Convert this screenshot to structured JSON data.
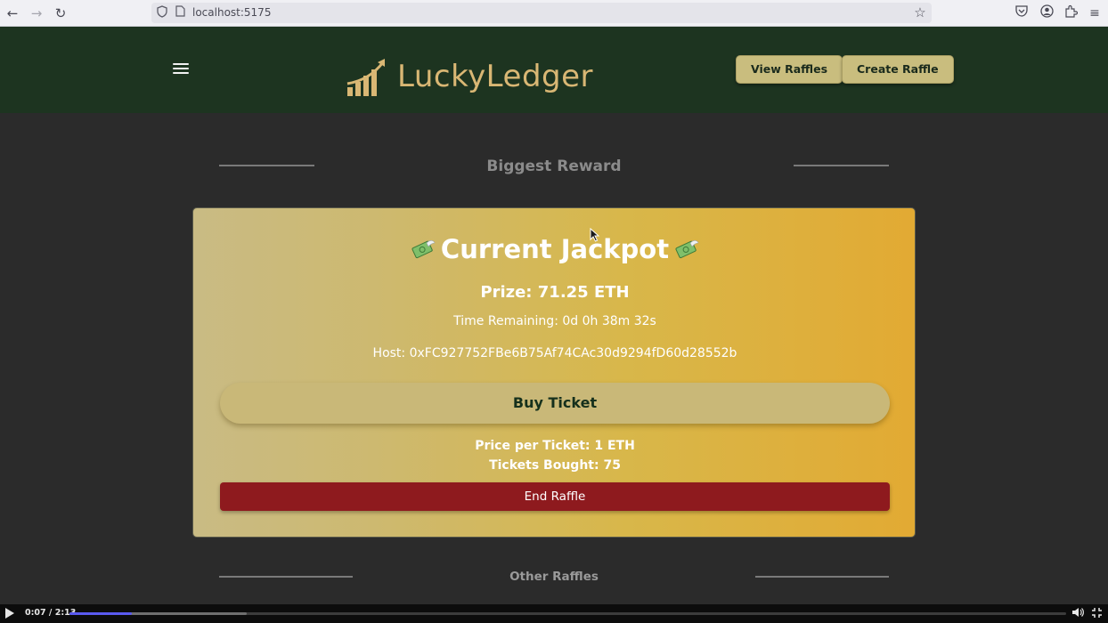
{
  "browser": {
    "url": "localhost:5175"
  },
  "header": {
    "logo_text": "LuckyLedger",
    "view_raffles_label": "View Raffles",
    "create_raffle_label": "Create Raffle",
    "bg_color": "#1d3420",
    "accent_color": "#d9b774"
  },
  "biggest_reward": {
    "section_title": "Biggest Reward",
    "card_title": "Current Jackpot",
    "prize": "Prize: 71.25 ETH",
    "time_remaining": "Time Remaining: 0d 0h 38m 32s",
    "host": "Host: 0xFC927752FBe6B75Af74CAc30d9294fD60d28552b",
    "buy_label": "Buy Ticket",
    "price_per_ticket": "Price per Ticket: 1 ETH",
    "tickets_bought": "Tickets Bought: 75",
    "end_label": "End Raffle",
    "title_icon": "money-with-wings-icon",
    "end_button_color": "#8e1a1e"
  },
  "other_raffles": {
    "section_title": "Other Raffles"
  },
  "video_player": {
    "time": "0:07 / 2:13",
    "progress_fraction": 0.0627,
    "buffered_fraction": 0.178
  }
}
